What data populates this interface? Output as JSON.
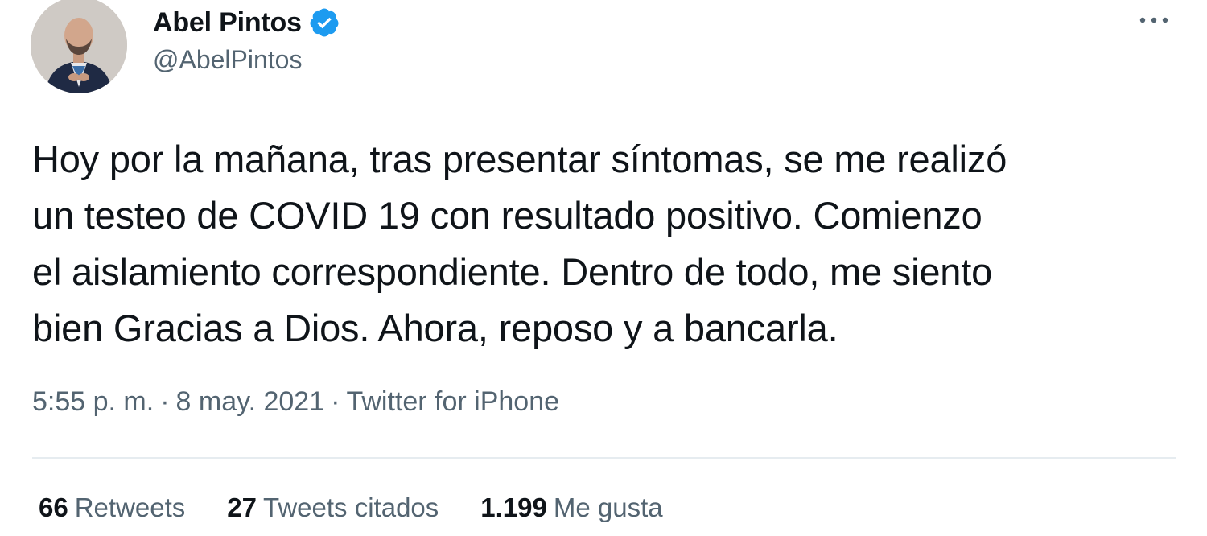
{
  "user": {
    "display_name": "Abel Pintos",
    "handle": "@AbelPintos",
    "verified": true,
    "avatar_icon": "profile-photo",
    "verified_icon": "verified-badge-icon",
    "accent_color": "#1d9bf0"
  },
  "menu": {
    "icon": "more-horizontal-icon"
  },
  "tweet": {
    "lines": [
      "Hoy por la mañana, tras presentar síntomas, se me realizó",
      "un testeo de COVID 19 con resultado positivo. Comienzo",
      "el aislamiento correspondiente. Dentro de todo, me siento",
      "bien Gracias a Dios. Ahora, reposo y a bancarla."
    ],
    "time": "5:55 p. m.",
    "date": "8 may. 2021",
    "separator": "·",
    "source": "Twitter for iPhone"
  },
  "stats": {
    "retweets_count": "66",
    "retweets_label": "Retweets",
    "quotes_count": "27",
    "quotes_label": "Tweets citados",
    "likes_count": "1.199",
    "likes_label": "Me gusta"
  },
  "colors": {
    "text_primary": "#0f1419",
    "text_secondary": "#536471",
    "divider": "#e6ecf0"
  }
}
